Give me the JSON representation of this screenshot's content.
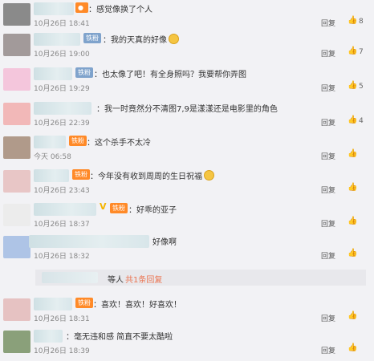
{
  "comments": [
    {
      "text": "：感觉像换了个人",
      "time": "10月26日 18:41",
      "reply": "回复",
      "likes": "8",
      "avatar_color": "#8a8a8a"
    },
    {
      "text": "：我的天真的好像",
      "time": "10月26日 19:00",
      "reply": "回复",
      "likes": "7",
      "badge": "铁粉",
      "avatar_color": "#a29a9a"
    },
    {
      "text": "：也太像了吧！有全身照吗？我要帮你弄图",
      "time": "10月26日 19:29",
      "reply": "回复",
      "likes": "5",
      "badge": "铁粉",
      "avatar_color": "#f4c6dc"
    },
    {
      "text": "：我一时竟然分不清图7,9是漾漾还是电影里的角色",
      "time": "10月26日 22:39",
      "reply": "回复",
      "likes": "4",
      "avatar_color": "#f2b8b8"
    },
    {
      "text": "：这个杀手不太冷",
      "time": "今天 06:58",
      "reply": "回复",
      "likes": "",
      "badge": "铁粉",
      "avatar_color": "#b09a8a"
    },
    {
      "text": "：今年没有收到周周的生日祝福",
      "time": "10月26日 23:43",
      "reply": "回复",
      "likes": "",
      "badge": "铁粉",
      "avatar_color": "#e8c6c6"
    },
    {
      "text": "：好乖的亚子",
      "time": "10月26日 18:37",
      "reply": "回复",
      "likes": "",
      "badge": "铁粉",
      "avatar_color": "#ececec"
    },
    {
      "text": "好像啊",
      "time": "10月26日 18:32",
      "reply": "回复",
      "likes": "",
      "avatar_color": "#aec4e6"
    },
    {
      "text": "：喜欢！喜欢！好喜欢！",
      "time": "10月26日 18:31",
      "reply": "回复",
      "likes": "",
      "badge": "铁粉",
      "avatar_color": "#e6c2c2"
    },
    {
      "text": "：毫无违和感 简直不要太酷啦",
      "time": "10月26日 18:39",
      "reply": "回复",
      "likes": "",
      "avatar_color": "#8aa07a"
    }
  ],
  "fold": {
    "text": "等人",
    "link": "共1条回复"
  }
}
